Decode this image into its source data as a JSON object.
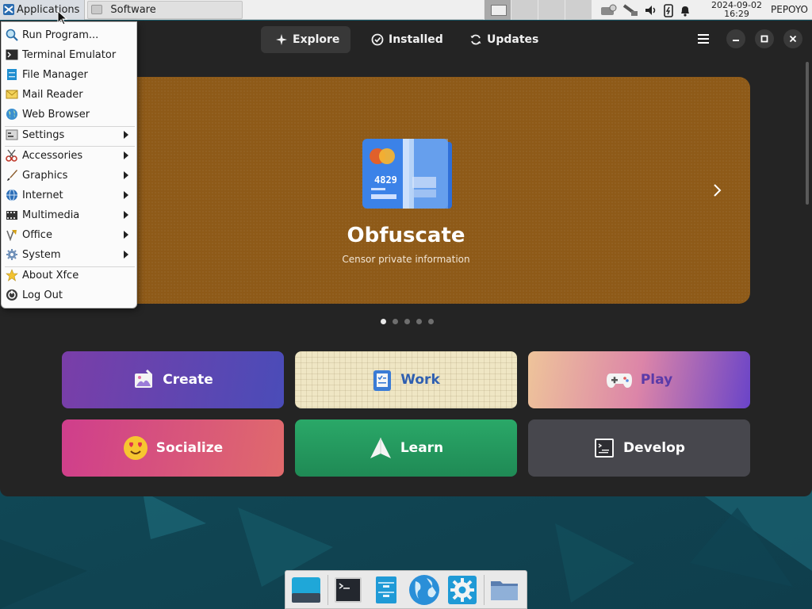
{
  "top_panel": {
    "applications_label": "Applications",
    "task_label": "Software",
    "date": "2024-09-02",
    "time": "16:29",
    "user": "PEPOYO"
  },
  "menu": {
    "items": [
      {
        "label": "Run Program...",
        "icon": "run-icon"
      },
      {
        "label": "Terminal Emulator",
        "icon": "terminal-icon"
      },
      {
        "label": "File Manager",
        "icon": "file-manager-icon"
      },
      {
        "label": "Mail Reader",
        "icon": "mail-icon"
      },
      {
        "label": "Web Browser",
        "icon": "globe-icon"
      },
      {
        "label": "Settings",
        "icon": "settings-icon",
        "submenu": true
      },
      {
        "label": "Accessories",
        "icon": "accessories-icon",
        "submenu": true
      },
      {
        "label": "Graphics",
        "icon": "graphics-icon",
        "submenu": true
      },
      {
        "label": "Internet",
        "icon": "internet-icon",
        "submenu": true
      },
      {
        "label": "Multimedia",
        "icon": "multimedia-icon",
        "submenu": true
      },
      {
        "label": "Office",
        "icon": "office-icon",
        "submenu": true
      },
      {
        "label": "System",
        "icon": "system-icon",
        "submenu": true
      },
      {
        "label": "About Xfce",
        "icon": "star-icon"
      },
      {
        "label": "Log Out",
        "icon": "logout-icon"
      }
    ]
  },
  "software": {
    "tabs": [
      {
        "label": "Explore",
        "icon": "sparkle-icon",
        "active": true
      },
      {
        "label": "Installed",
        "icon": "check-circle-icon"
      },
      {
        "label": "Updates",
        "icon": "refresh-icon"
      }
    ],
    "banner": {
      "title": "Obfuscate",
      "subtitle": "Censor private information",
      "card_number": "4829",
      "color": "#8e5a18",
      "active_slide": 1,
      "slide_count": 5
    },
    "categories": [
      {
        "label": "Create",
        "icon": "create-icon"
      },
      {
        "label": "Work",
        "icon": "work-icon"
      },
      {
        "label": "Play",
        "icon": "gamepad-icon"
      },
      {
        "label": "Socialize",
        "icon": "heart-eyes-emoji-icon"
      },
      {
        "label": "Learn",
        "icon": "paper-plane-icon"
      },
      {
        "label": "Develop",
        "icon": "terminal-code-icon"
      }
    ]
  },
  "dock": {
    "items": [
      "desktop-icon",
      "terminal-icon",
      "file-manager-icon",
      "web-browser-icon",
      "settings-gear-icon",
      "folder-icon"
    ]
  },
  "colors": {
    "window_bg": "#242424",
    "panel_bg": "#efefef",
    "desktop_bg": "#16505e"
  }
}
